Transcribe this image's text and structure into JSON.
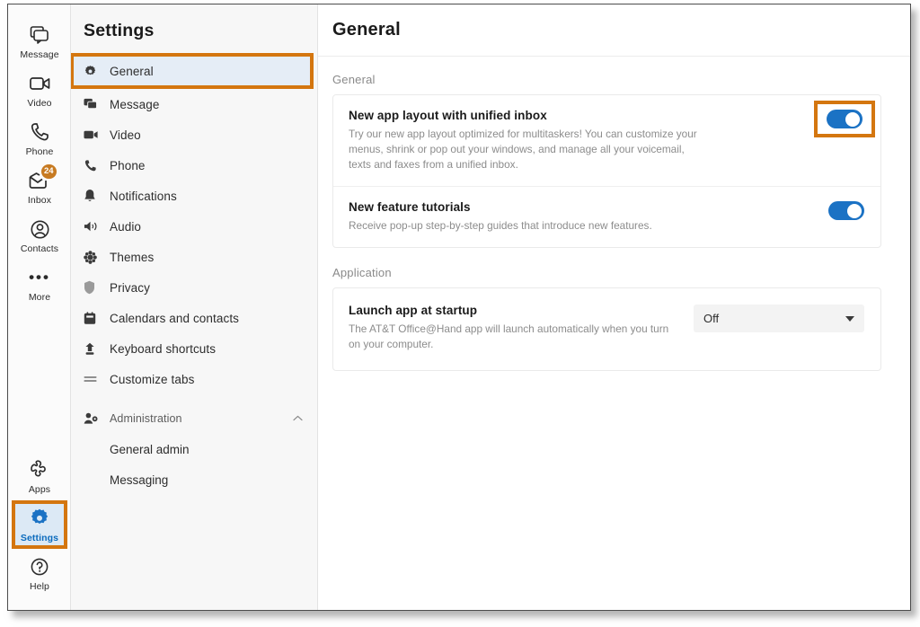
{
  "app_rail": {
    "top_items": [
      {
        "label": "Message",
        "icon": "message-icon"
      },
      {
        "label": "Video",
        "icon": "video-icon"
      },
      {
        "label": "Phone",
        "icon": "phone-icon"
      },
      {
        "label": "Inbox",
        "icon": "inbox-icon",
        "badge": "24"
      },
      {
        "label": "Contacts",
        "icon": "contacts-icon"
      },
      {
        "label": "More",
        "icon": "more-dots-icon"
      }
    ],
    "bottom_items": [
      {
        "label": "Apps",
        "icon": "apps-icon"
      },
      {
        "label": "Settings",
        "icon": "gear-icon",
        "active": true
      },
      {
        "label": "Help",
        "icon": "help-question-icon"
      }
    ]
  },
  "settings_nav": {
    "title": "Settings",
    "items": [
      {
        "label": "General",
        "icon": "gear-icon",
        "selected": true,
        "highlighted": true
      },
      {
        "label": "Message",
        "icon": "message-icon"
      },
      {
        "label": "Video",
        "icon": "video-icon"
      },
      {
        "label": "Phone",
        "icon": "phone-icon"
      },
      {
        "label": "Notifications",
        "icon": "bell-icon"
      },
      {
        "label": "Audio",
        "icon": "speaker-icon"
      },
      {
        "label": "Themes",
        "icon": "palette-icon"
      },
      {
        "label": "Privacy",
        "icon": "shield-icon"
      },
      {
        "label": "Calendars and contacts",
        "icon": "calendar-icon"
      },
      {
        "label": "Keyboard shortcuts",
        "icon": "keyboard-icon"
      },
      {
        "label": "Customize tabs",
        "icon": "list-lines-icon"
      }
    ],
    "administration": {
      "label": "Administration",
      "icon": "person-gear-icon",
      "chevron": "chevron-up-icon",
      "sub_items": [
        {
          "label": "General admin"
        },
        {
          "label": "Messaging"
        }
      ]
    }
  },
  "main": {
    "page_title": "General",
    "sections": [
      {
        "label": "General",
        "rows": [
          {
            "title": "New app layout with unified inbox",
            "desc": "Try our new app layout optimized for multitaskers! You can customize your menus, shrink or pop out your windows, and manage all your voicemail, texts and faxes from a unified inbox.",
            "control": "toggle",
            "toggle_on": true,
            "highlighted": true
          },
          {
            "title": "New feature tutorials",
            "desc": "Receive pop-up step-by-step guides that introduce new features.",
            "control": "toggle",
            "toggle_on": true,
            "highlighted": false
          }
        ]
      },
      {
        "label": "Application",
        "rows": [
          {
            "title": "Launch app at startup",
            "desc": "The AT&T Office@Hand app will launch automatically when you turn on your computer.",
            "control": "select",
            "select_value": "Off",
            "highlighted": false
          }
        ]
      }
    ]
  },
  "colors": {
    "highlight_orange": "#d4760f",
    "toggle_blue": "#1b72c4",
    "selected_blue_bg": "#e5edf6",
    "badge_orange": "#c77a21",
    "active_label_blue": "#0b6bbd"
  }
}
